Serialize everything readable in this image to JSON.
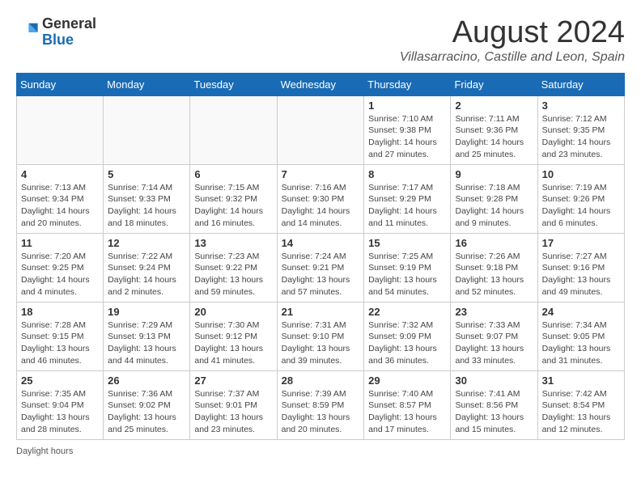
{
  "header": {
    "logo_general": "General",
    "logo_blue": "Blue",
    "month_year": "August 2024",
    "location": "Villasarracino, Castille and Leon, Spain"
  },
  "days_of_week": [
    "Sunday",
    "Monday",
    "Tuesday",
    "Wednesday",
    "Thursday",
    "Friday",
    "Saturday"
  ],
  "weeks": [
    [
      {
        "day": "",
        "detail": ""
      },
      {
        "day": "",
        "detail": ""
      },
      {
        "day": "",
        "detail": ""
      },
      {
        "day": "",
        "detail": ""
      },
      {
        "day": "1",
        "detail": "Sunrise: 7:10 AM\nSunset: 9:38 PM\nDaylight: 14 hours and 27 minutes."
      },
      {
        "day": "2",
        "detail": "Sunrise: 7:11 AM\nSunset: 9:36 PM\nDaylight: 14 hours and 25 minutes."
      },
      {
        "day": "3",
        "detail": "Sunrise: 7:12 AM\nSunset: 9:35 PM\nDaylight: 14 hours and 23 minutes."
      }
    ],
    [
      {
        "day": "4",
        "detail": "Sunrise: 7:13 AM\nSunset: 9:34 PM\nDaylight: 14 hours and 20 minutes."
      },
      {
        "day": "5",
        "detail": "Sunrise: 7:14 AM\nSunset: 9:33 PM\nDaylight: 14 hours and 18 minutes."
      },
      {
        "day": "6",
        "detail": "Sunrise: 7:15 AM\nSunset: 9:32 PM\nDaylight: 14 hours and 16 minutes."
      },
      {
        "day": "7",
        "detail": "Sunrise: 7:16 AM\nSunset: 9:30 PM\nDaylight: 14 hours and 14 minutes."
      },
      {
        "day": "8",
        "detail": "Sunrise: 7:17 AM\nSunset: 9:29 PM\nDaylight: 14 hours and 11 minutes."
      },
      {
        "day": "9",
        "detail": "Sunrise: 7:18 AM\nSunset: 9:28 PM\nDaylight: 14 hours and 9 minutes."
      },
      {
        "day": "10",
        "detail": "Sunrise: 7:19 AM\nSunset: 9:26 PM\nDaylight: 14 hours and 6 minutes."
      }
    ],
    [
      {
        "day": "11",
        "detail": "Sunrise: 7:20 AM\nSunset: 9:25 PM\nDaylight: 14 hours and 4 minutes."
      },
      {
        "day": "12",
        "detail": "Sunrise: 7:22 AM\nSunset: 9:24 PM\nDaylight: 14 hours and 2 minutes."
      },
      {
        "day": "13",
        "detail": "Sunrise: 7:23 AM\nSunset: 9:22 PM\nDaylight: 13 hours and 59 minutes."
      },
      {
        "day": "14",
        "detail": "Sunrise: 7:24 AM\nSunset: 9:21 PM\nDaylight: 13 hours and 57 minutes."
      },
      {
        "day": "15",
        "detail": "Sunrise: 7:25 AM\nSunset: 9:19 PM\nDaylight: 13 hours and 54 minutes."
      },
      {
        "day": "16",
        "detail": "Sunrise: 7:26 AM\nSunset: 9:18 PM\nDaylight: 13 hours and 52 minutes."
      },
      {
        "day": "17",
        "detail": "Sunrise: 7:27 AM\nSunset: 9:16 PM\nDaylight: 13 hours and 49 minutes."
      }
    ],
    [
      {
        "day": "18",
        "detail": "Sunrise: 7:28 AM\nSunset: 9:15 PM\nDaylight: 13 hours and 46 minutes."
      },
      {
        "day": "19",
        "detail": "Sunrise: 7:29 AM\nSunset: 9:13 PM\nDaylight: 13 hours and 44 minutes."
      },
      {
        "day": "20",
        "detail": "Sunrise: 7:30 AM\nSunset: 9:12 PM\nDaylight: 13 hours and 41 minutes."
      },
      {
        "day": "21",
        "detail": "Sunrise: 7:31 AM\nSunset: 9:10 PM\nDaylight: 13 hours and 39 minutes."
      },
      {
        "day": "22",
        "detail": "Sunrise: 7:32 AM\nSunset: 9:09 PM\nDaylight: 13 hours and 36 minutes."
      },
      {
        "day": "23",
        "detail": "Sunrise: 7:33 AM\nSunset: 9:07 PM\nDaylight: 13 hours and 33 minutes."
      },
      {
        "day": "24",
        "detail": "Sunrise: 7:34 AM\nSunset: 9:05 PM\nDaylight: 13 hours and 31 minutes."
      }
    ],
    [
      {
        "day": "25",
        "detail": "Sunrise: 7:35 AM\nSunset: 9:04 PM\nDaylight: 13 hours and 28 minutes."
      },
      {
        "day": "26",
        "detail": "Sunrise: 7:36 AM\nSunset: 9:02 PM\nDaylight: 13 hours and 25 minutes."
      },
      {
        "day": "27",
        "detail": "Sunrise: 7:37 AM\nSunset: 9:01 PM\nDaylight: 13 hours and 23 minutes."
      },
      {
        "day": "28",
        "detail": "Sunrise: 7:39 AM\nSunset: 8:59 PM\nDaylight: 13 hours and 20 minutes."
      },
      {
        "day": "29",
        "detail": "Sunrise: 7:40 AM\nSunset: 8:57 PM\nDaylight: 13 hours and 17 minutes."
      },
      {
        "day": "30",
        "detail": "Sunrise: 7:41 AM\nSunset: 8:56 PM\nDaylight: 13 hours and 15 minutes."
      },
      {
        "day": "31",
        "detail": "Sunrise: 7:42 AM\nSunset: 8:54 PM\nDaylight: 13 hours and 12 minutes."
      }
    ]
  ],
  "daylight_note": "Daylight hours"
}
